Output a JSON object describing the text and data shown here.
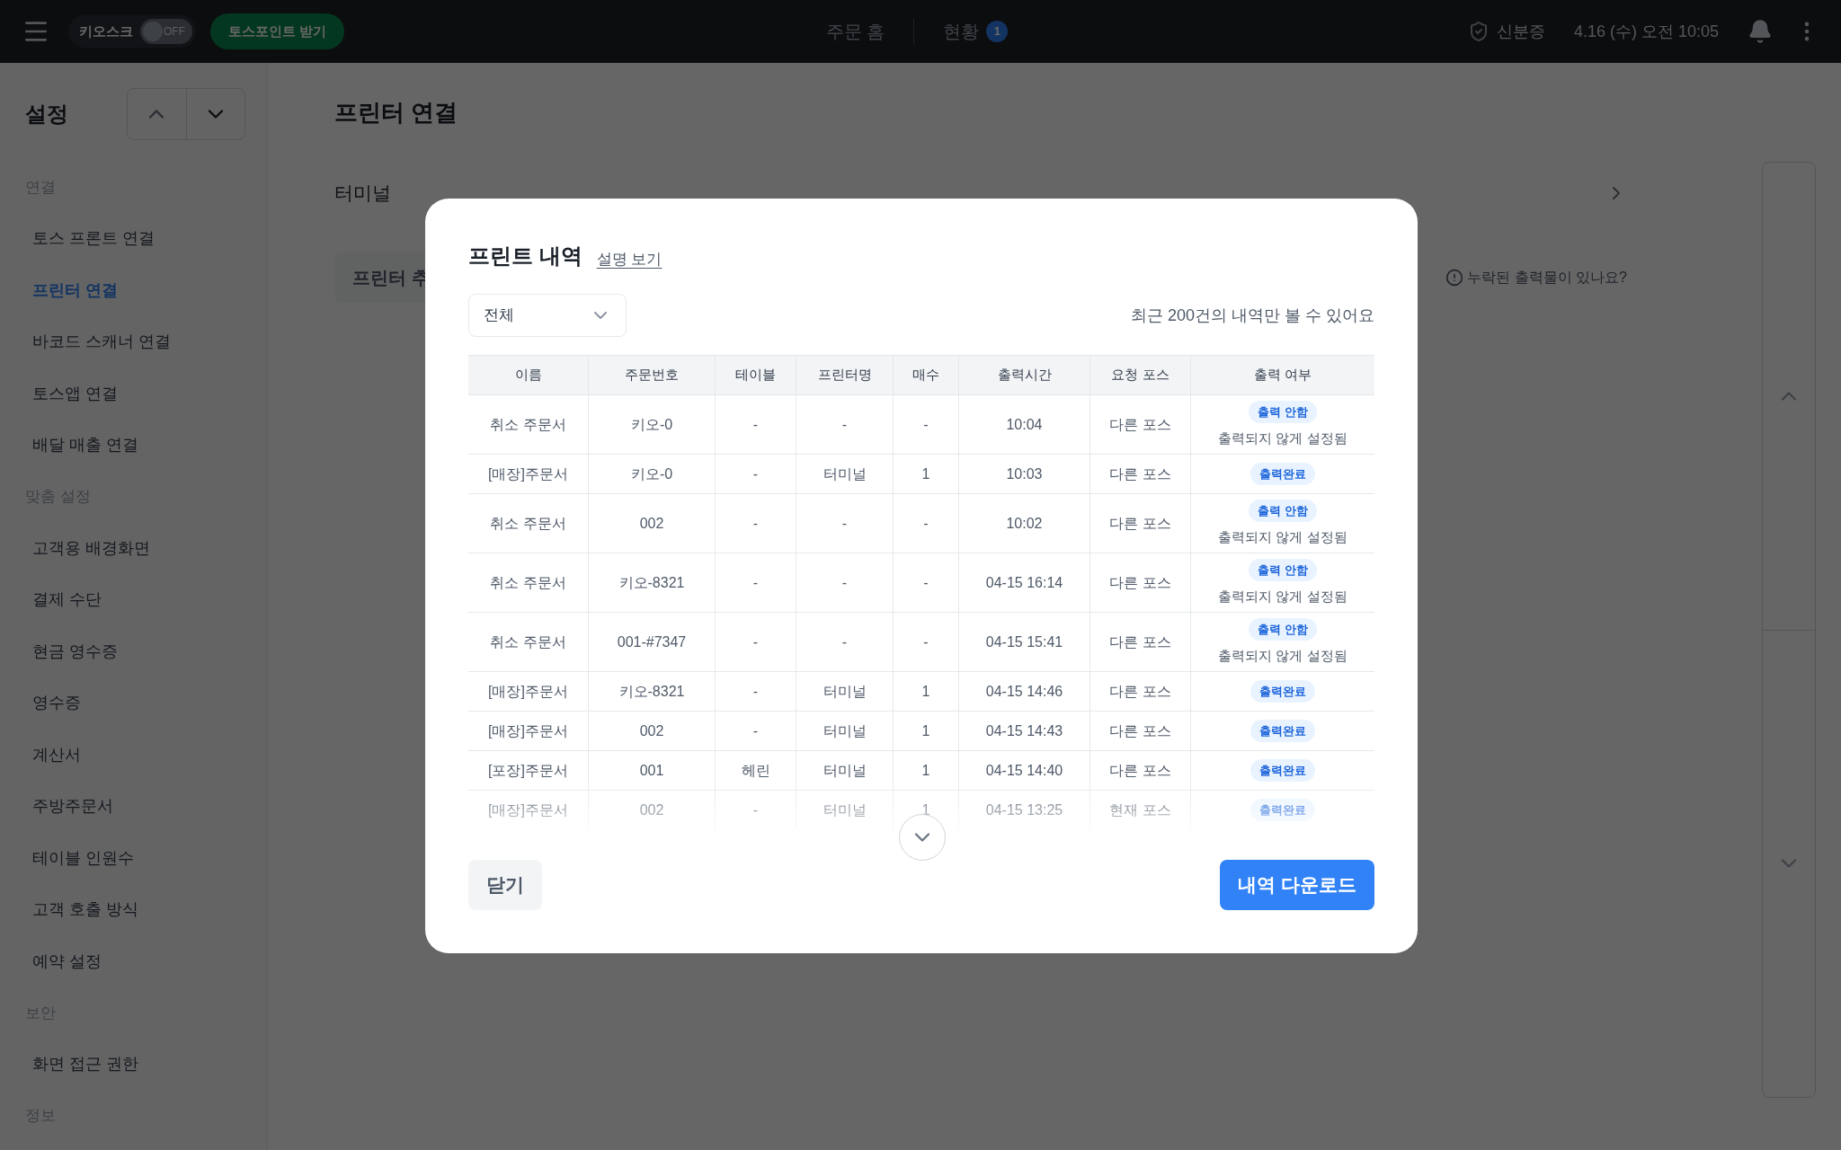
{
  "top_bar": {
    "kiosk": {
      "label": "키오스크",
      "toggle_text": "OFF",
      "on": false
    },
    "points_button": "토스포인트 받기",
    "nav": [
      {
        "label": "주문 홈"
      },
      {
        "label": "현황",
        "badge": "1"
      }
    ],
    "id_label": "신분증",
    "datetime": "4.16 (수) 오전 10:05"
  },
  "sidebar": {
    "title": "설정",
    "sections": [
      {
        "label": "연결",
        "items": [
          {
            "label": "토스 프론트 연결",
            "selected": false
          },
          {
            "label": "프린터 연결",
            "selected": true
          },
          {
            "label": "바코드 스캐너 연결",
            "selected": false
          },
          {
            "label": "토스앱 연결",
            "selected": false
          },
          {
            "label": "배달 매출 연결",
            "selected": false
          }
        ]
      },
      {
        "label": "맞춤 설정",
        "items": [
          {
            "label": "고객용 배경화면",
            "selected": false
          },
          {
            "label": "결제 수단",
            "selected": false
          },
          {
            "label": "현금 영수증",
            "selected": false
          },
          {
            "label": "영수증",
            "selected": false
          },
          {
            "label": "계산서",
            "selected": false
          },
          {
            "label": "주방주문서",
            "selected": false
          },
          {
            "label": "테이블 인원수",
            "selected": false
          },
          {
            "label": "고객 호출 방식",
            "selected": false
          },
          {
            "label": "예약 설정",
            "selected": false
          }
        ]
      },
      {
        "label": "보안",
        "items": [
          {
            "label": "화면 접근 권한",
            "selected": false
          }
        ]
      },
      {
        "label": "정보"
      }
    ]
  },
  "main": {
    "title": "프린터 연결",
    "terminal_label": "터미널",
    "add_printer_button": "프린터 추",
    "missing_hint": "누락된 출력물이 있나요?"
  },
  "modal": {
    "title": "프린트 내역",
    "help_link": "설명 보기",
    "filter": {
      "value": "전체"
    },
    "notice": "최근 200건의 내역만 볼 수 있어요",
    "table": {
      "columns": [
        "이름",
        "주문번호",
        "테이블",
        "프린터명",
        "매수",
        "출력시간",
        "요청 포스",
        "출력 여부"
      ],
      "rows": [
        {
          "cells": [
            "취소 주문서",
            "키오-0",
            "-",
            "-",
            "-",
            "10:04",
            "다른 포스"
          ],
          "status": "출력 안함",
          "note": "출력되지 않게 설정됨"
        },
        {
          "cells": [
            "[매장]주문서",
            "키오-0",
            "-",
            "터미널",
            "1",
            "10:03",
            "다른 포스"
          ],
          "status": "출력완료"
        },
        {
          "cells": [
            "취소 주문서",
            "002",
            "-",
            "-",
            "-",
            "10:02",
            "다른 포스"
          ],
          "status": "출력 안함",
          "note": "출력되지 않게 설정됨"
        },
        {
          "cells": [
            "취소 주문서",
            "키오-8321",
            "-",
            "-",
            "-",
            "04-15 16:14",
            "다른 포스"
          ],
          "status": "출력 안함",
          "note": "출력되지 않게 설정됨"
        },
        {
          "cells": [
            "취소 주문서",
            "001-#7347",
            "-",
            "-",
            "-",
            "04-15 15:41",
            "다른 포스"
          ],
          "status": "출력 안함",
          "note": "출력되지 않게 설정됨"
        },
        {
          "cells": [
            "[매장]주문서",
            "키오-8321",
            "-",
            "터미널",
            "1",
            "04-15 14:46",
            "다른 포스"
          ],
          "status": "출력완료"
        },
        {
          "cells": [
            "[매장]주문서",
            "002",
            "-",
            "터미널",
            "1",
            "04-15 14:43",
            "다른 포스"
          ],
          "status": "출력완료"
        },
        {
          "cells": [
            "[포장]주문서",
            "001",
            "헤린",
            "터미널",
            "1",
            "04-15 14:40",
            "다른 포스"
          ],
          "status": "출력완료"
        },
        {
          "cells": [
            "[매장]주문서",
            "002",
            "-",
            "터미널",
            "1",
            "04-15 13:25",
            "현재 포스"
          ],
          "status": "출력완료"
        }
      ]
    },
    "close_button": "닫기",
    "download_button": "내역 다운로드"
  }
}
